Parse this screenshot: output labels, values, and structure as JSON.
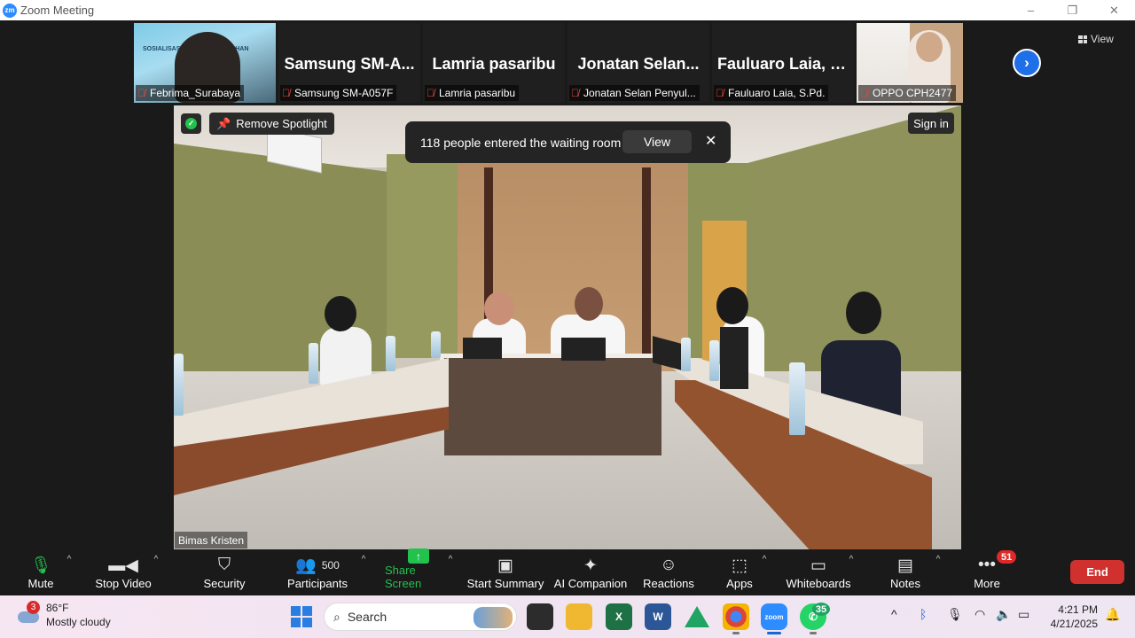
{
  "window": {
    "title": "Zoom Meeting",
    "logo": "zm",
    "controls": [
      "–",
      "❐",
      "✕"
    ]
  },
  "gallery": {
    "tiles": [
      {
        "label": "Febrima_Surabaya",
        "has_video": true,
        "slide_text": "SOSIALISASI PET... IS PADA ... HAN"
      },
      {
        "name": "Samsung  SM-A...",
        "label": "Samsung SM-A057F",
        "has_video": false
      },
      {
        "name": "Lamria pasaribu",
        "label": "Lamria pasaribu",
        "has_video": false
      },
      {
        "name": "Jonatan  Selan...",
        "label": "Jonatan  Selan  Penyul...",
        "has_video": false
      },
      {
        "name": "Fauluaro Laia, S...",
        "label": "Fauluaro Laia, S.Pd.",
        "has_video": false
      },
      {
        "label": "OPPO CPH2477",
        "has_video": true
      }
    ],
    "view_label": "View",
    "next_icon": "chevron-right-icon"
  },
  "spotlight": {
    "remove_spotlight_label": "Remove Spotlight",
    "notification": {
      "text": "118 people entered the waiting room",
      "view_label": "View",
      "close_label": "✕"
    },
    "sign_in_label": "Sign in",
    "participant_name": "Bimas Kristen"
  },
  "toolbar": {
    "mute_label": "Mute",
    "stop_video_label": "Stop Video",
    "security_label": "Security",
    "participants_label": "Participants",
    "participants_count": "500",
    "share_screen_label": "Share Screen",
    "start_summary_label": "Start Summary",
    "ai_companion_label": "AI Companion",
    "reactions_label": "Reactions",
    "apps_label": "Apps",
    "whiteboards_label": "Whiteboards",
    "notes_label": "Notes",
    "more_label": "More",
    "more_badge": "51",
    "end_label": "End"
  },
  "taskbar": {
    "weather_temp": "86°F",
    "weather_desc": "Mostly cloudy",
    "weather_badge": "3",
    "search_placeholder": "Search",
    "whatsapp_badge": "35",
    "time": "4:21 PM",
    "date": "4/21/2025"
  },
  "colors": {
    "accent_green": "#23c24d",
    "end_red": "#d0312f",
    "badge_red": "#e02828",
    "zoom_blue": "#2d8cff"
  }
}
